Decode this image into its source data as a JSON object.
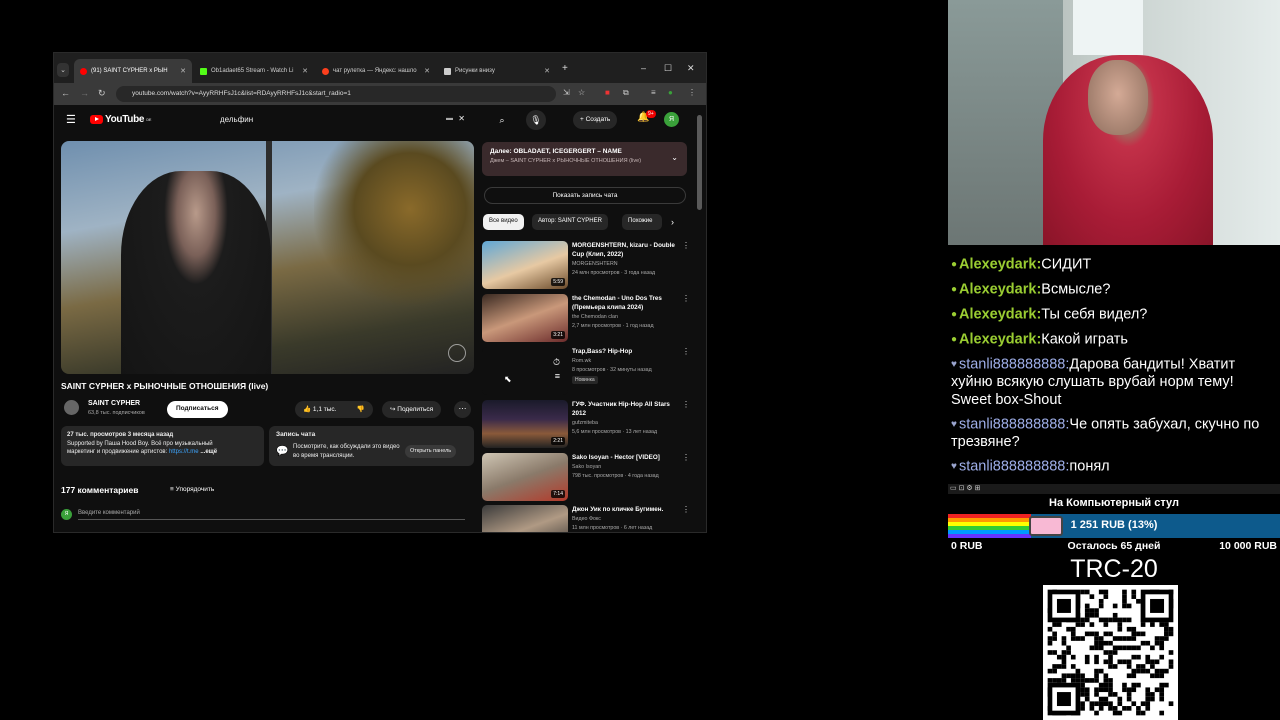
{
  "browser": {
    "tabs": [
      {
        "label": "(91) SAINT CYPHER x РЫН",
        "color": "#ff0000",
        "active": true
      },
      {
        "label": "Ob1adaet65 Stream - Watch Li",
        "color": "#53fc18",
        "active": false
      },
      {
        "label": "чат рулетка — Яндекс: нашло",
        "color": "#fc3f1d",
        "active": false
      },
      {
        "label": "Рисунки внизу",
        "color": "#cccccc",
        "active": false
      }
    ],
    "new_tab": "+",
    "url": "youtube.com/watch?v=AyyRRHFsJ1c&list=RDAyyRRHFsJ1c&start_radio=1"
  },
  "youtube": {
    "logo": "YouTube",
    "logo_region": "DE",
    "search_value": "дельфин",
    "create_label": "Создать",
    "notif_count": "9+",
    "avatar_letter": "Я",
    "video_title": "SAINT CYPHER x РЫНОЧНЫЕ ОТНОШЕНИЯ (live)",
    "channel_name": "SAINT CYPHER",
    "channel_subs": "63,8 тыс. подписчиков",
    "subscribe_label": "Подписаться",
    "like_count": "1,1 тыс.",
    "share_label": "Поделиться",
    "description": {
      "stats": "27 тыс. просмотров  3 месяца назад",
      "line2": "Supported by Паша Hood Boy. Всё про музыкальный",
      "line3": "маркетинг и продвижение артистов:",
      "link": "https://t.me",
      "more": "...ещё"
    },
    "chat_record": {
      "title": "Запись чата",
      "text": "Посмотрите, как обсуждали это видео во время трансляции.",
      "button": "Открыть панель"
    },
    "comments_count": "177 комментариев",
    "sort_label": "Упорядочить",
    "comment_placeholder": "Введите комментарий",
    "up_next": {
      "title": "Далее: OBLADAET, ICEGERGERT – NAME",
      "subtitle": "Джем – SAINT CYPHER x РЫНОЧНЫЕ ОТНОШЕНИЯ (live)"
    },
    "show_chat": "Показать запись чата",
    "chips": [
      "Все видео",
      "Автор: SAINT CYPHER",
      "Похожие"
    ],
    "recommendations": [
      {
        "title": "MORGENSHTERN, kizaru - Double Cup (Клип, 2022)",
        "channel": "MORGENSHTERN",
        "meta": "24 млн просмотров · 3 года назад",
        "duration": "5:59"
      },
      {
        "title": "the Chemodan - Uno Dos Tres (Премьера клипа 2024)",
        "channel": "the Chemodan clan",
        "meta": "2,7 млн просмотров · 1 год назад",
        "duration": "3:21"
      },
      {
        "title": "Trap,Bass? Hip-Hop",
        "channel": "Rom.wk",
        "meta": "8 просмотров · 32 минуты назад",
        "badge": "Новинка",
        "duration": ""
      },
      {
        "title": "ГУФ. Участник Hip-Hop All Stars 2012",
        "channel": "gufzmiteba",
        "meta": "5,6 млн просмотров · 13 лет назад",
        "duration": "2:21"
      },
      {
        "title": "Sako Isoyan - Hector [VIDEO]",
        "channel": "Sako Isoyan",
        "meta": "798 тыс. просмотров · 4 года назад",
        "duration": "7:14"
      },
      {
        "title": "Джон Уик по кличке Бугимен.",
        "channel": "Видео Фокс",
        "meta": "11 млн просмотров · 6 лет назад",
        "duration": ""
      }
    ]
  },
  "chat": {
    "messages": [
      {
        "user": "Alexeydark",
        "text": "СИДИТ"
      },
      {
        "user": "Alexeydark",
        "text": "Всмысле?"
      },
      {
        "user": "Alexeydark",
        "text": "Ты себя видел?"
      },
      {
        "user": "Alexeydark",
        "text": "Какой играть"
      },
      {
        "user": "stanli888888888",
        "text": "Дарова бандиты! Хватит хуйню всякую слушать врубай норм тему! Sweet box-Shout"
      },
      {
        "user": "stanli888888888",
        "text": "Че опять забухал, скучно по трезвяне?"
      },
      {
        "user": "stanli888888888",
        "text": "понял"
      }
    ]
  },
  "donation": {
    "title": "На Компьютерный стул",
    "current": "1 251 RUB (13%)",
    "progress": 0.13,
    "min": "0 RUB",
    "days_left": "Осталось 65 дней",
    "max": "10 000 RUB",
    "wallet_label": "TRC-20"
  }
}
